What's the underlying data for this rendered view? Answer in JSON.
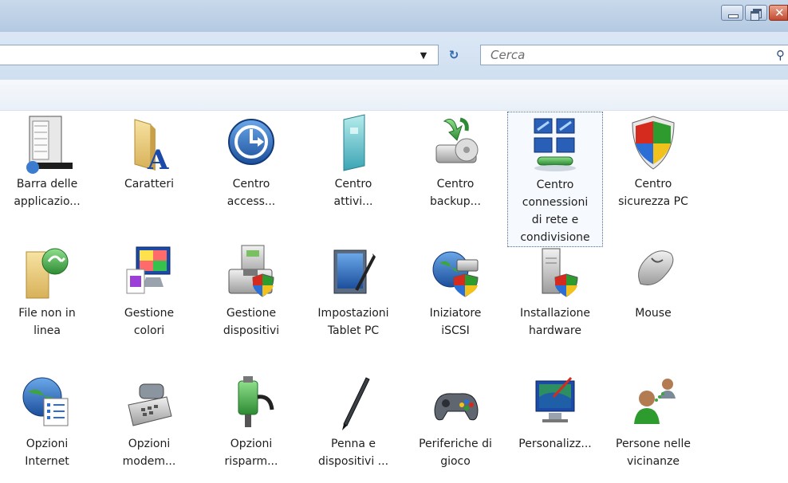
{
  "window": {
    "buttons": {
      "minimize": "minimize-icon",
      "maximize": "restore-icon",
      "close": "close-icon"
    }
  },
  "address": {
    "search_placeholder": "Cerca",
    "dropdown_icon": "chevron-down-icon",
    "refresh_icon": "refresh-icon",
    "search_icon": "magnifier-icon"
  },
  "items": [
    {
      "line1": "Barra delle",
      "line2": "applicazio...",
      "icon": "taskbar-icon"
    },
    {
      "line1": "Caratteri",
      "line2": "",
      "icon": "fonts-folder-icon"
    },
    {
      "line1": "Centro",
      "line2": "access...",
      "icon": "ease-of-access-icon"
    },
    {
      "line1": "Centro",
      "line2": "attivi...",
      "icon": "sync-center-icon"
    },
    {
      "line1": "Centro",
      "line2": "backup...",
      "icon": "backup-icon"
    },
    {
      "line1": "Centro",
      "line2": "connessioni",
      "line3": "di rete e",
      "line4": "condivisione",
      "icon": "network-center-icon",
      "selected": true
    },
    {
      "line1": "Centro",
      "line2": "sicurezza PC",
      "icon": "security-shield-icon"
    },
    {
      "line1": "File non in",
      "line2": "linea",
      "icon": "offline-files-icon"
    },
    {
      "line1": "Gestione",
      "line2": "colori",
      "icon": "color-management-icon"
    },
    {
      "line1": "Gestione",
      "line2": "dispositivi",
      "icon": "device-manager-icon"
    },
    {
      "line1": "Impostazioni",
      "line2": "Tablet PC",
      "icon": "tablet-pc-icon"
    },
    {
      "line1": "Iniziatore",
      "line2": "iSCSI",
      "icon": "iscsi-icon"
    },
    {
      "line1": "Installazione",
      "line2": "hardware",
      "icon": "add-hardware-icon"
    },
    {
      "line1": "Mouse",
      "line2": "",
      "icon": "mouse-icon"
    },
    {
      "line1": "Opzioni",
      "line2": "Internet",
      "icon": "internet-options-icon"
    },
    {
      "line1": "Opzioni",
      "line2": "modem...",
      "icon": "phone-modem-icon"
    },
    {
      "line1": "Opzioni",
      "line2": "risparm...",
      "icon": "power-options-icon"
    },
    {
      "line1": "Penna e",
      "line2": "dispositivi ...",
      "icon": "pen-input-icon"
    },
    {
      "line1": "Periferiche di",
      "line2": "gioco",
      "icon": "game-controller-icon"
    },
    {
      "line1": "Personalizz...",
      "line2": "",
      "icon": "personalization-icon"
    },
    {
      "line1": "Persone nelle",
      "line2": "vicinanze",
      "icon": "people-near-me-icon"
    }
  ]
}
